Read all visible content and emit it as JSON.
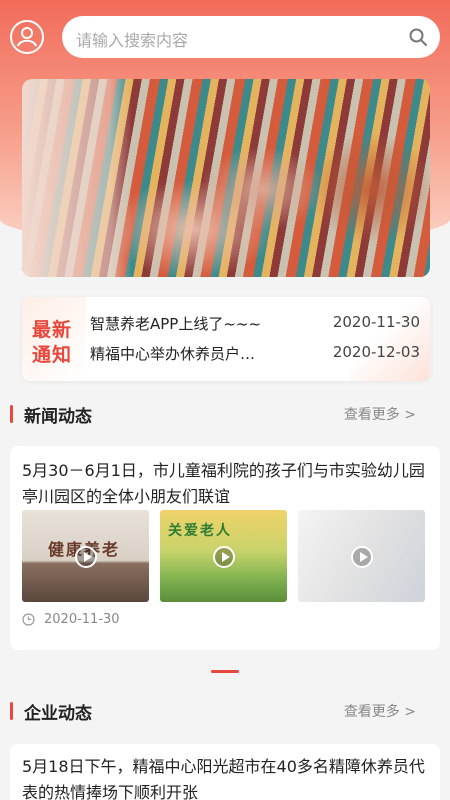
{
  "search": {
    "placeholder": "请输入搜索内容"
  },
  "icons": {
    "avatar": "user-icon",
    "search": "search-icon",
    "play": "play-icon",
    "clock": "clock-icon"
  },
  "colors": {
    "accent": "#e8483b",
    "header_top": "#f26b5a",
    "header_bottom": "#fbd3c6"
  },
  "notice": {
    "badge_line1": "最新",
    "badge_line2": "通知",
    "items": [
      {
        "title": "智慧养老APP上线了~~~",
        "date": "2020-11-30"
      },
      {
        "title": "精福中心举办休养员户…",
        "date": "2020-12-03"
      }
    ]
  },
  "news": {
    "title": "新闻动态",
    "more": "查看更多 >",
    "card": {
      "title": "5月30－6月1日，市儿童福利院的孩子们与市实验幼儿园亭川园区的全体小朋友们联谊",
      "thumb1_text": "健康养老",
      "thumb2_text": "关爱老人",
      "date": "2020-11-30"
    }
  },
  "enterprise": {
    "title": "企业动态",
    "more": "查看更多 >",
    "card": {
      "title": "5月18日下午，精福中心阳光超市在40多名精障休养员代表的热情捧场下顺利开张"
    }
  }
}
